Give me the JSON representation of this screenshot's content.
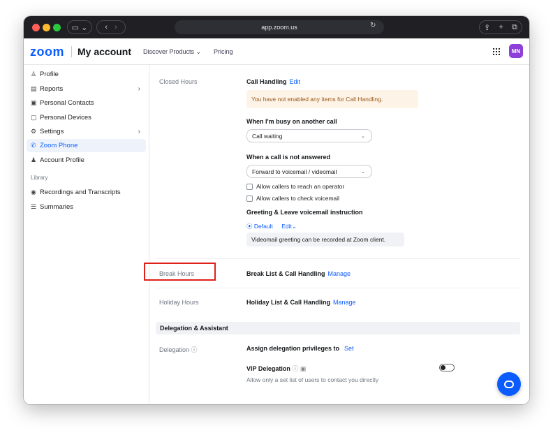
{
  "browser": {
    "url": "app.zoom.us",
    "traffic_lights": [
      "#ff5f57",
      "#febc2e",
      "#28c840"
    ]
  },
  "header": {
    "logo": "zoom",
    "title": "My account",
    "nav": [
      "Discover Products",
      "Pricing"
    ],
    "avatar_initials": "MN",
    "avatar_color": "#8c3fd9"
  },
  "sidebar": {
    "items": [
      {
        "label": "Profile",
        "icon": "person-icon"
      },
      {
        "label": "Reports",
        "icon": "report-icon",
        "chevron": "›"
      },
      {
        "label": "Personal Contacts",
        "icon": "contacts-icon"
      },
      {
        "label": "Personal Devices",
        "icon": "devices-icon"
      },
      {
        "label": "Settings",
        "icon": "gear-icon",
        "chevron": "›"
      },
      {
        "label": "Zoom Phone",
        "icon": "phone-icon",
        "active": true
      },
      {
        "label": "Account Profile",
        "icon": "account-icon"
      }
    ],
    "library_label": "Library",
    "library_items": [
      {
        "label": "Recordings and Transcripts",
        "icon": "record-icon"
      },
      {
        "label": "Summaries",
        "icon": "summary-icon"
      }
    ]
  },
  "main": {
    "closed_hours": {
      "label": "Closed Hours",
      "call_handling_title": "Call Handling",
      "edit_link": "Edit",
      "warning": "You have not enabled any items for Call Handling.",
      "busy_title": "When I'm busy on another call",
      "busy_value": "Call waiting",
      "not_answered_title": "When a call is not answered",
      "not_answered_value": "Forward to voicemail / videomail",
      "checkbox_operator": "Allow callers to reach an operator",
      "checkbox_voicemail": "Allow callers to check voicemail",
      "greeting_title": "Greeting & Leave voicemail instruction",
      "default_label": "Default",
      "edit_dropdown": "Edit",
      "info_text": "Videomail greeting can be recorded at Zoom client."
    },
    "break_hours": {
      "label": "Break Hours",
      "title": "Break List & Call Handling",
      "link": "Manage"
    },
    "holiday_hours": {
      "label": "Holiday Hours",
      "title": "Holiday List & Call Handling",
      "link": "Manage"
    },
    "delegation_section": "Delegation & Assistant",
    "delegation": {
      "label": "Delegation",
      "title": "Assign delegation privileges to",
      "link": "Set",
      "vip_title": "VIP Delegation",
      "vip_desc": "Allow only a set list of users to contact you directly",
      "vip_enabled": false
    }
  },
  "colors": {
    "accent": "#0b5cff",
    "highlight_box": "#e0201b"
  }
}
